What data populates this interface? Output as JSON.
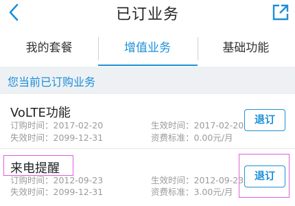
{
  "header": {
    "title": "已订业务"
  },
  "tabs": [
    {
      "label": "我的套餐"
    },
    {
      "label": "增值业务"
    },
    {
      "label": "基础功能"
    }
  ],
  "section": {
    "title": "您当前已订购业务"
  },
  "services": [
    {
      "name": "VoLTE功能",
      "order_time": "订购时间：2017-02-20",
      "effective_time": "生效时间：2017-02-20",
      "expire_time": "失效时间：2099-12-31",
      "fee": "资费标准：0.00元/月",
      "button": "退订"
    },
    {
      "name": "来电提醒",
      "order_time": "订购时间：2012-09-23",
      "effective_time": "生效时间：2012-09-23",
      "expire_time": "失效时间：2099-12-31",
      "fee": "资费标准：3.00元/月",
      "button": "退订"
    }
  ],
  "colors": {
    "accent": "#1a8fd9",
    "highlight": "#e05be0",
    "section_bg": "#eef1f4"
  }
}
